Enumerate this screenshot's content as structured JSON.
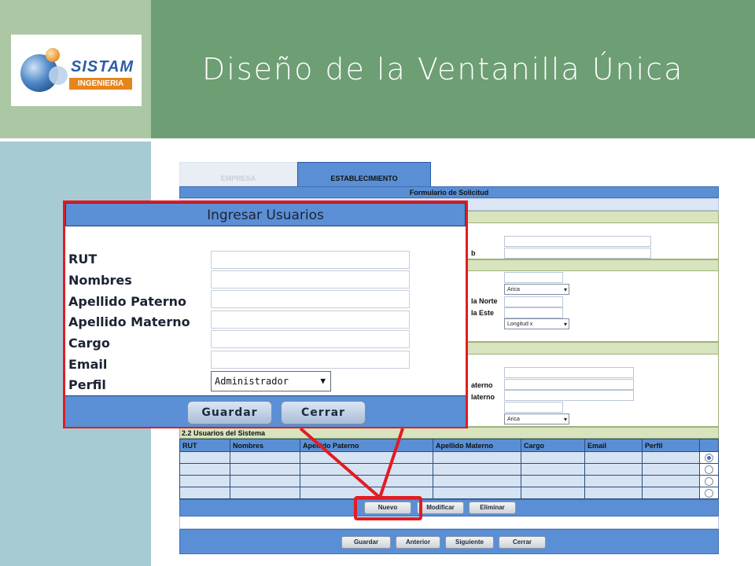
{
  "slide": {
    "title": "Diseño de la Ventanilla Única",
    "logo": {
      "brand": "SISTAM",
      "sub": "INGENIERIA"
    }
  },
  "form": {
    "tabs": [
      "EMPRESA",
      "ESTABLECIMIENTO"
    ],
    "header": "Formulario de Solicitud",
    "partial_labels": [
      "b",
      "la Norte",
      "la Este",
      "aterno",
      "laterno"
    ],
    "selects": [
      "Arica",
      "Longitud x",
      "Arica"
    ],
    "users_section": "2.2 Usuarios del Sistema",
    "users_table": {
      "headers": [
        "RUT",
        "Nombres",
        "Apellido Paterno",
        "Apellido Materno",
        "Cargo",
        "Email",
        "Perfil",
        ""
      ],
      "rows": 4,
      "selected_row": 0
    },
    "row_buttons": [
      "Nuevo",
      "Modificar",
      "Eliminar"
    ],
    "nav_buttons": [
      "Guardar",
      "Anterior",
      "Siguiente",
      "Cerrar"
    ]
  },
  "dialog": {
    "title": "Ingresar Usuarios",
    "fields": [
      "RUT",
      "Nombres",
      "Apellido Paterno",
      "Apellido Materno",
      "Cargo",
      "Email",
      "Perfil"
    ],
    "perfil_value": "Administrador",
    "buttons": [
      "Guardar",
      "Cerrar"
    ]
  },
  "colors": {
    "header_green": "#6e9e74",
    "form_blue": "#5a8fd5",
    "callout_red": "#e31b23"
  }
}
